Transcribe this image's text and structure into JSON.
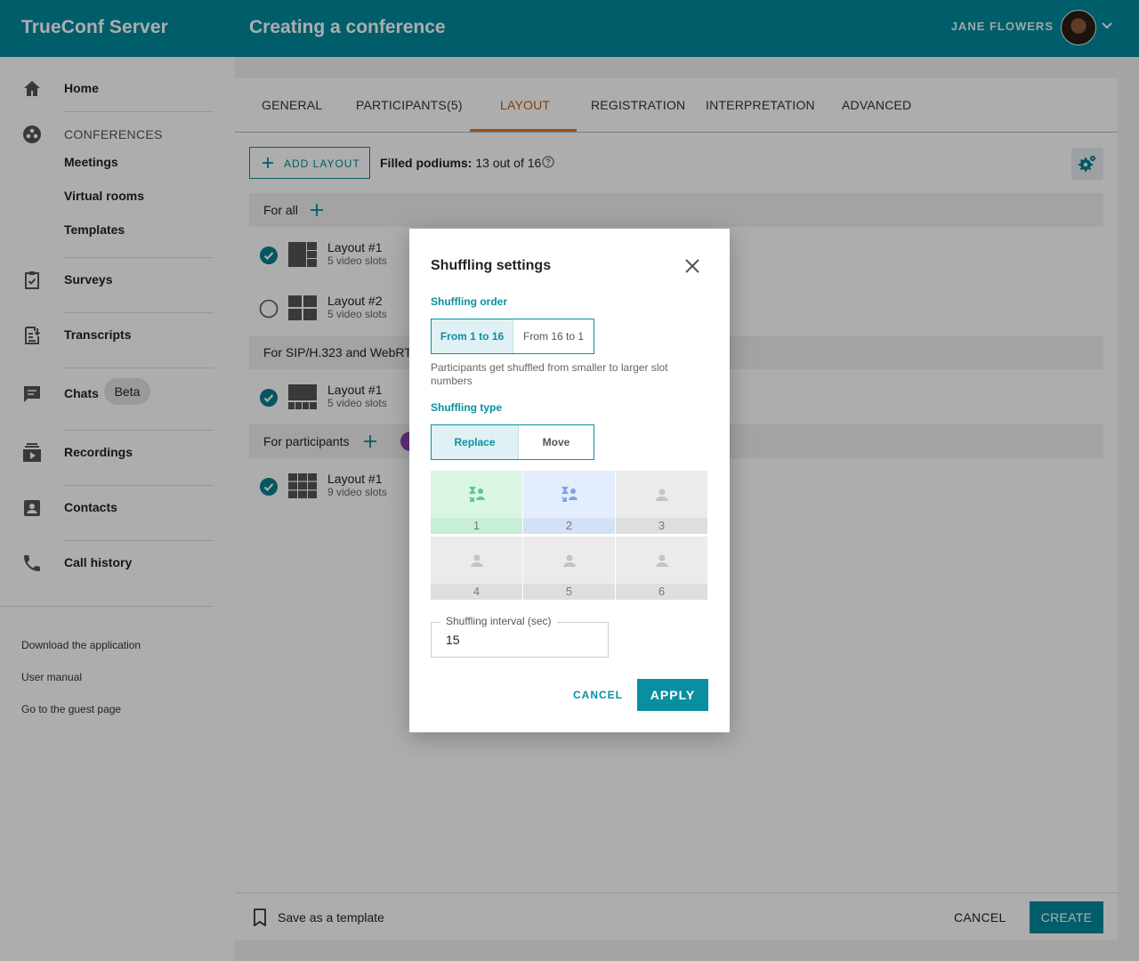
{
  "header": {
    "brand": "TrueConf Server",
    "page_title": "Creating a conference",
    "user_name": "JANE FLOWERS",
    "icons": {
      "user_menu": "chevron-down-icon"
    }
  },
  "sidebar": {
    "home": "Home",
    "conferences_section": "CONFERENCES",
    "meetings": "Meetings",
    "virtual_rooms": "Virtual rooms",
    "templates": "Templates",
    "surveys": "Surveys",
    "transcripts": "Transcripts",
    "chats": "Chats",
    "chats_badge": "Beta",
    "recordings": "Recordings",
    "contacts": "Contacts",
    "call_history": "Call history",
    "links": [
      "Download the application",
      "User manual",
      "Go to the guest page"
    ]
  },
  "tabs": [
    "GENERAL",
    "PARTICIPANTS(5)",
    "LAYOUT",
    "REGISTRATION",
    "INTERPRETATION",
    "ADVANCED"
  ],
  "active_tab": "LAYOUT",
  "toolbar": {
    "add_layout": "ADD LAYOUT",
    "filled_label": "Filled podiums:",
    "filled_value": "13 out of 16"
  },
  "groups": {
    "for_all": "For all",
    "for_sip": "For SIP/H.323 and WebRTC",
    "for_participants": "For participants"
  },
  "layouts": [
    {
      "name": "Layout #1",
      "slots": "5 video slots",
      "selected": true
    },
    {
      "name": "Layout #2",
      "slots": "5 video slots",
      "selected": false
    },
    {
      "name": "Layout #1",
      "slots": "5 video slots",
      "selected": true
    },
    {
      "name": "Layout #1",
      "slots": "9 video slots",
      "selected": true
    }
  ],
  "footer": {
    "save_template": "Save as a template",
    "cancel": "CANCEL",
    "create": "CREATE"
  },
  "modal": {
    "title": "Shuffling settings",
    "order_label": "Shuffling order",
    "order_options": [
      "From 1 to 16",
      "From 16 to 1"
    ],
    "order_selected": "From 1 to 16",
    "description": "Participants get shuffled from smaller to larger slot numbers",
    "type_label": "Shuffling type",
    "type_options": [
      "Replace",
      "Move"
    ],
    "type_selected": "Replace",
    "slots": [
      "1",
      "2",
      "3",
      "4",
      "5",
      "6"
    ],
    "interval_label": "Shuffling interval (sec)",
    "interval_value": "15",
    "cancel": "CANCEL",
    "apply": "APPLY"
  },
  "colors": {
    "brand": "#008a9c",
    "accent_tab": "#e07a2a",
    "modal_accent": "#0a8fa0"
  }
}
